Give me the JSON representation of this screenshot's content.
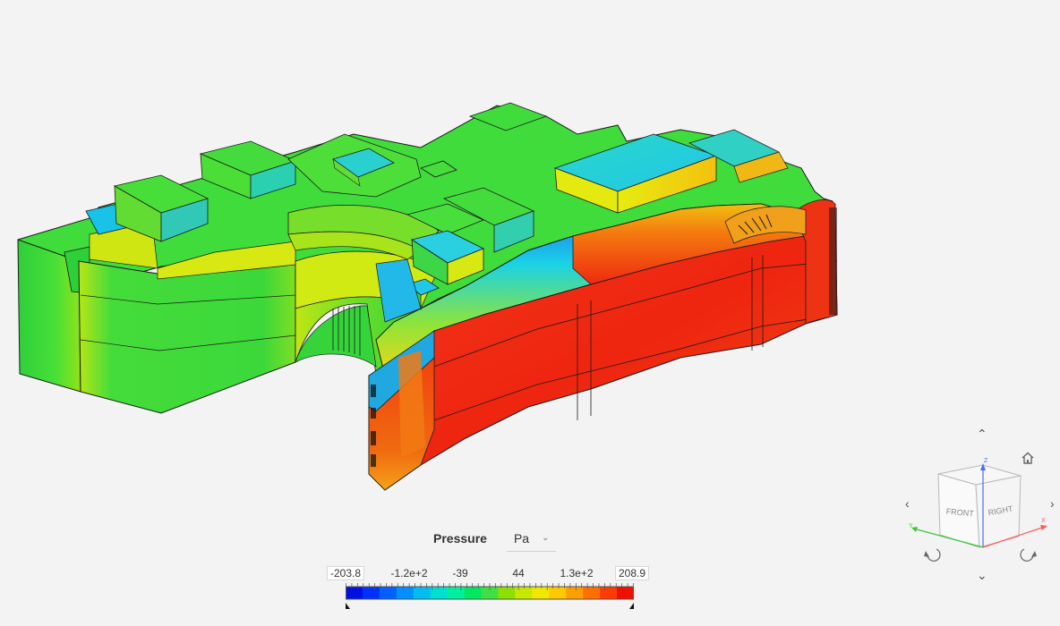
{
  "legend": {
    "field": "Pressure",
    "unit": "Pa",
    "unit_icon": "chevron-down-icon",
    "min_label": "-203.8",
    "max_label": "208.9",
    "ticks": [
      "-1.2e+2",
      "-39",
      "44",
      "1.3e+2"
    ],
    "min_value": -203.8,
    "max_value": 208.9,
    "colormap": [
      "#0010e0",
      "#0030ff",
      "#0060ff",
      "#0090ff",
      "#00bff0",
      "#00e0d0",
      "#00f0a0",
      "#00e860",
      "#40e040",
      "#8ee000",
      "#c8e800",
      "#f0e800",
      "#ffc800",
      "#ff9e00",
      "#ff7000",
      "#ff3c00",
      "#f01000"
    ]
  },
  "viewcube": {
    "front_label": "FRONT",
    "right_label": "RIGHT",
    "x_axis_label": "X",
    "y_axis_label": "Y",
    "z_axis_label": "Z",
    "up_icon": "chevron-up-icon",
    "down_icon": "chevron-down-icon",
    "left_icon": "chevron-left-icon",
    "right_icon": "chevron-right-icon",
    "home_icon": "home-icon",
    "rotate_ccw_icon": "rotate-ccw-icon",
    "rotate_cw_icon": "rotate-cw-icon"
  },
  "colors": {
    "background": "#f3f3f3",
    "blue": "#0a1cff",
    "cyan": "#17d8e8",
    "green": "#33dd33",
    "yellow": "#e8f20a",
    "orange": "#f07a1a",
    "red": "#ea1a0a"
  }
}
